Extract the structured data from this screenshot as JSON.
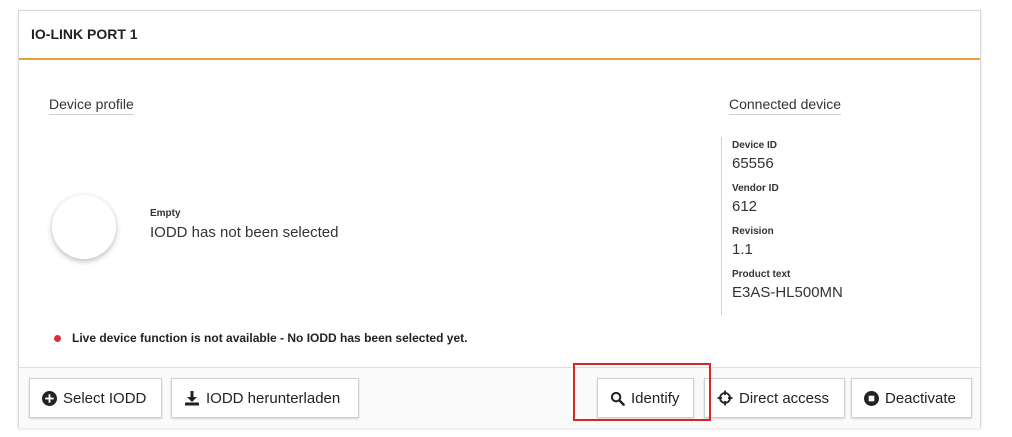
{
  "header": {
    "title": "IO-LINK PORT 1"
  },
  "profile": {
    "section_title": "Device profile",
    "empty_label": "Empty",
    "empty_value": "IODD has not been selected"
  },
  "device": {
    "section_title": "Connected device",
    "fields": [
      {
        "label": "Device ID",
        "value": "65556"
      },
      {
        "label": "Vendor ID",
        "value": "612"
      },
      {
        "label": "Revision",
        "value": "1.1"
      },
      {
        "label": "Product text",
        "value": "E3AS-HL500MN"
      }
    ]
  },
  "notice": {
    "text": "Live device function is not available - No IODD has been selected yet.",
    "status_color": "#d9313d"
  },
  "buttons": {
    "select_iodd": {
      "label": "Select IODD",
      "icon": "plus-circle-icon"
    },
    "download_iodd": {
      "label": "IODD herunterladen",
      "icon": "download-icon"
    },
    "identify": {
      "label": "Identify",
      "icon": "search-icon"
    },
    "direct_access": {
      "label": "Direct access",
      "icon": "crosshair-icon"
    },
    "deactivate": {
      "label": "Deactivate",
      "icon": "stop-circle-icon"
    }
  },
  "colors": {
    "accent": "#e8a23a",
    "highlight": "#d42828"
  }
}
